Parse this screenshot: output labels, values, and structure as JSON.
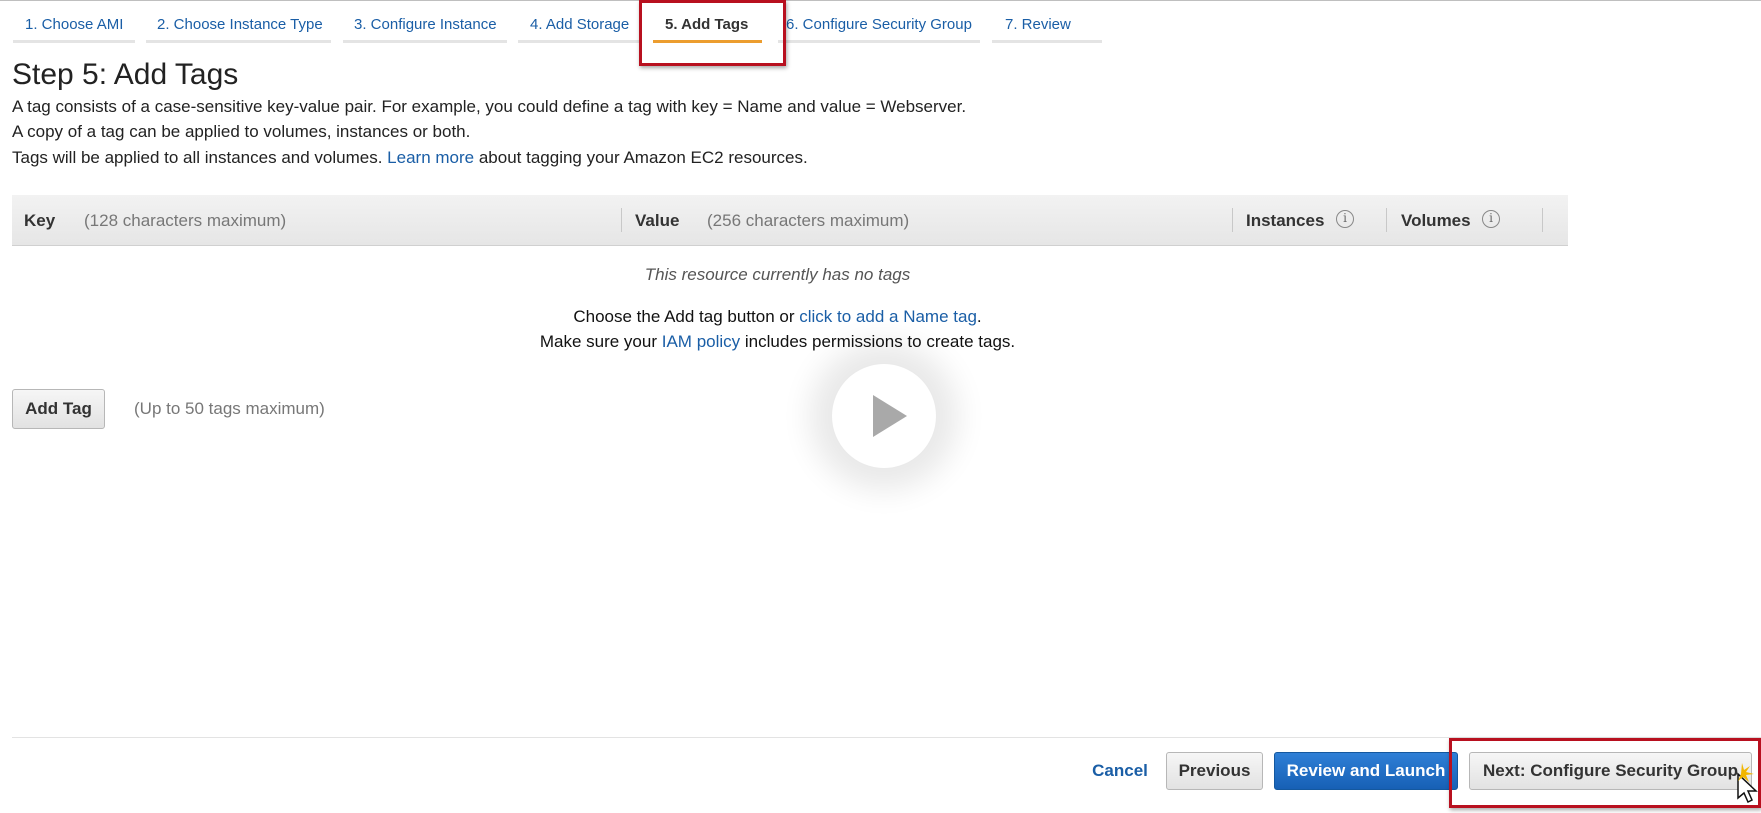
{
  "wizard": {
    "tabs": [
      {
        "label": "1. Choose AMI"
      },
      {
        "label": "2. Choose Instance Type"
      },
      {
        "label": "3. Configure Instance"
      },
      {
        "label": "4. Add Storage"
      },
      {
        "label": "5. Add Tags",
        "active": true
      },
      {
        "label": "6. Configure Security Group"
      },
      {
        "label": "7. Review"
      }
    ]
  },
  "page": {
    "title": "Step 5: Add Tags",
    "desc1": "A tag consists of a case-sensitive key-value pair. For example, you could define a tag with key = Name and value = Webserver.",
    "desc2": "A copy of a tag can be applied to volumes, instances or both.",
    "desc3_before": "Tags will be applied to all instances and volumes.",
    "desc3_link": "Learn more",
    "desc3_after": "about tagging your Amazon EC2 resources."
  },
  "table": {
    "key_label": "Key",
    "key_hint": "(128 characters maximum)",
    "value_label": "Value",
    "value_hint": "(256 characters maximum)",
    "instances_label": "Instances",
    "volumes_label": "Volumes",
    "info_glyph": "i",
    "empty_message": "This resource currently has no tags",
    "line1_before": "Choose the Add tag button or",
    "line1_link": "click to add a Name tag",
    "line1_after": ".",
    "line2_before": "Make sure your",
    "line2_link": "IAM policy",
    "line2_after": "includes permissions to create tags."
  },
  "actions": {
    "add_tag_label": "Add Tag",
    "add_tag_hint": "(Up to 50 tags maximum)"
  },
  "footer": {
    "cancel_label": "Cancel",
    "previous_label": "Previous",
    "review_label": "Review and Launch",
    "next_label": "Next: Configure Security Group"
  },
  "colors": {
    "link": "#1a5ea6",
    "primary": "#1e6cc4",
    "active_tab_underline": "#ec9d2f",
    "highlight_box": "#b8101f"
  },
  "icons": [
    "info-icon",
    "play-icon",
    "cursor-icon"
  ]
}
